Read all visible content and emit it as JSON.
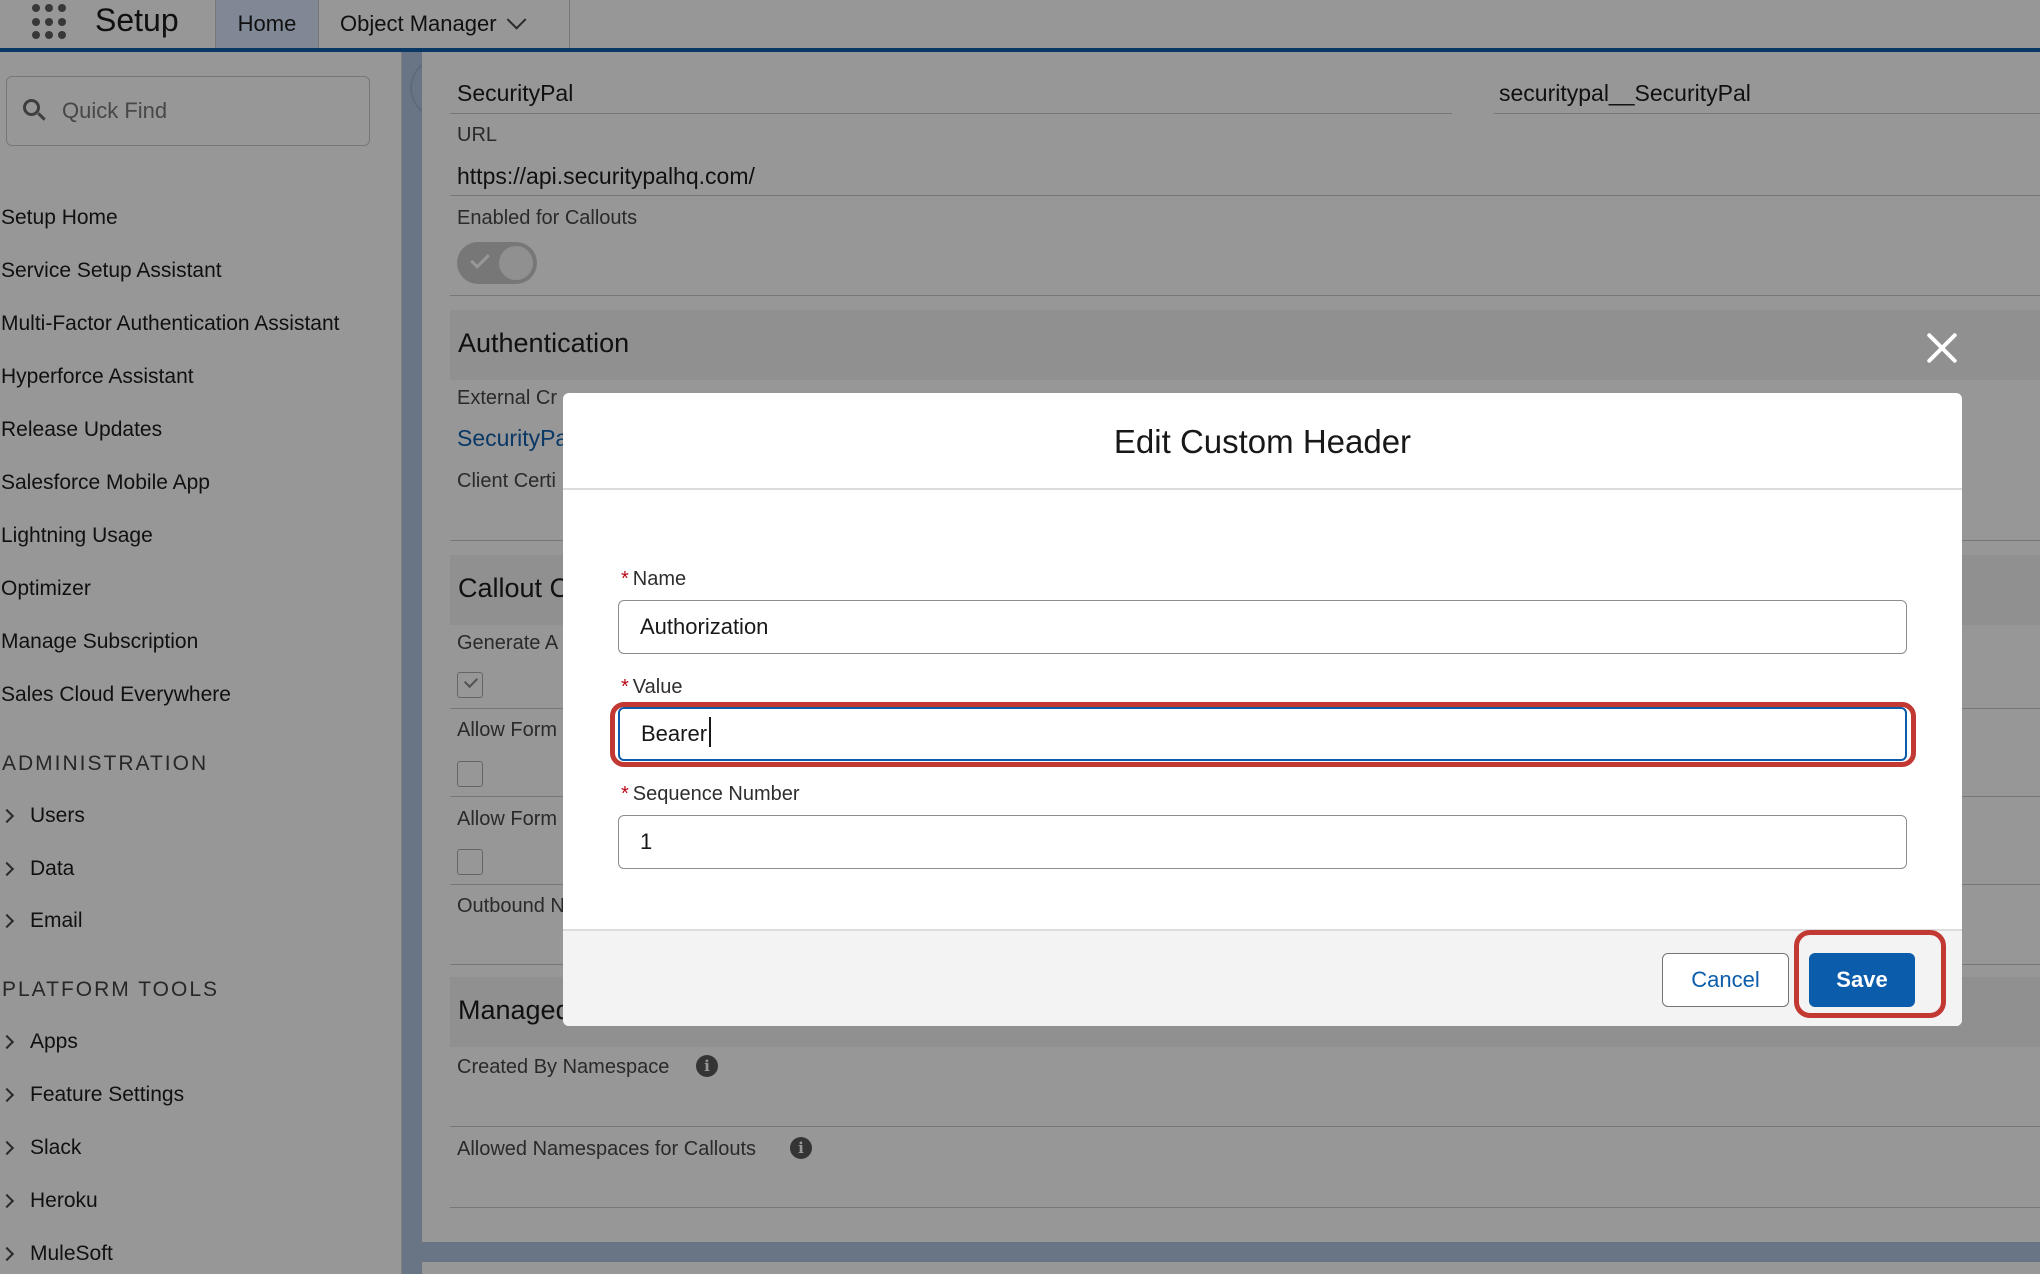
{
  "topnav": {
    "app_title": "Setup",
    "tabs": [
      {
        "label": "Home"
      },
      {
        "label": "Object Manager"
      }
    ]
  },
  "sidebar": {
    "search_placeholder": "Quick Find",
    "links": [
      {
        "label": "Setup Home"
      },
      {
        "label": "Service Setup Assistant"
      },
      {
        "label": "Multi-Factor Authentication Assistant"
      },
      {
        "label": "Hyperforce Assistant"
      },
      {
        "label": "Release Updates"
      },
      {
        "label": "Salesforce Mobile App"
      },
      {
        "label": "Lightning Usage"
      },
      {
        "label": "Optimizer"
      },
      {
        "label": "Manage Subscription"
      },
      {
        "label": "Sales Cloud Everywhere"
      }
    ],
    "administration": {
      "heading": "ADMINISTRATION",
      "items": [
        {
          "label": "Users"
        },
        {
          "label": "Data"
        },
        {
          "label": "Email"
        }
      ]
    },
    "platform_tools": {
      "heading": "PLATFORM TOOLS",
      "items": [
        {
          "label": "Apps"
        },
        {
          "label": "Feature Settings"
        },
        {
          "label": "Slack"
        },
        {
          "label": "Heroku"
        },
        {
          "label": "MuleSoft"
        }
      ]
    }
  },
  "main": {
    "label_value": "SecurityPal",
    "name_value": "securitypal__SecurityPal",
    "url_label": "URL",
    "url_value": "https://api.securitypalhq.com/",
    "enabled_label": "Enabled for Callouts",
    "enabled_value": true,
    "auth_heading": "Authentication",
    "ext_cred_label": "External Cr",
    "ext_cred_value": "SecurityPa",
    "client_cert_label": "Client Certi",
    "callout_heading": "Callout C",
    "generate_label": "Generate A",
    "allow_form_1_label": "Allow Form",
    "allow_form_2_label": "Allow Form",
    "outbound_label": "Outbound N",
    "managed_heading": "Managed",
    "created_ns_label": "Created By Namespace",
    "allowed_ns_label": "Allowed Namespaces for Callouts"
  },
  "modal": {
    "title": "Edit Custom Header",
    "name_label": "Name",
    "name_value": "Authorization",
    "value_label": "Value",
    "value_value": "Bearer ",
    "seq_label": "Sequence Number",
    "seq_value": "1",
    "required_marker": "*",
    "cancel_label": "Cancel",
    "save_label": "Save"
  },
  "colors": {
    "brand": "#0b5cab",
    "highlight": "#c23934",
    "required": "#ba0517"
  }
}
